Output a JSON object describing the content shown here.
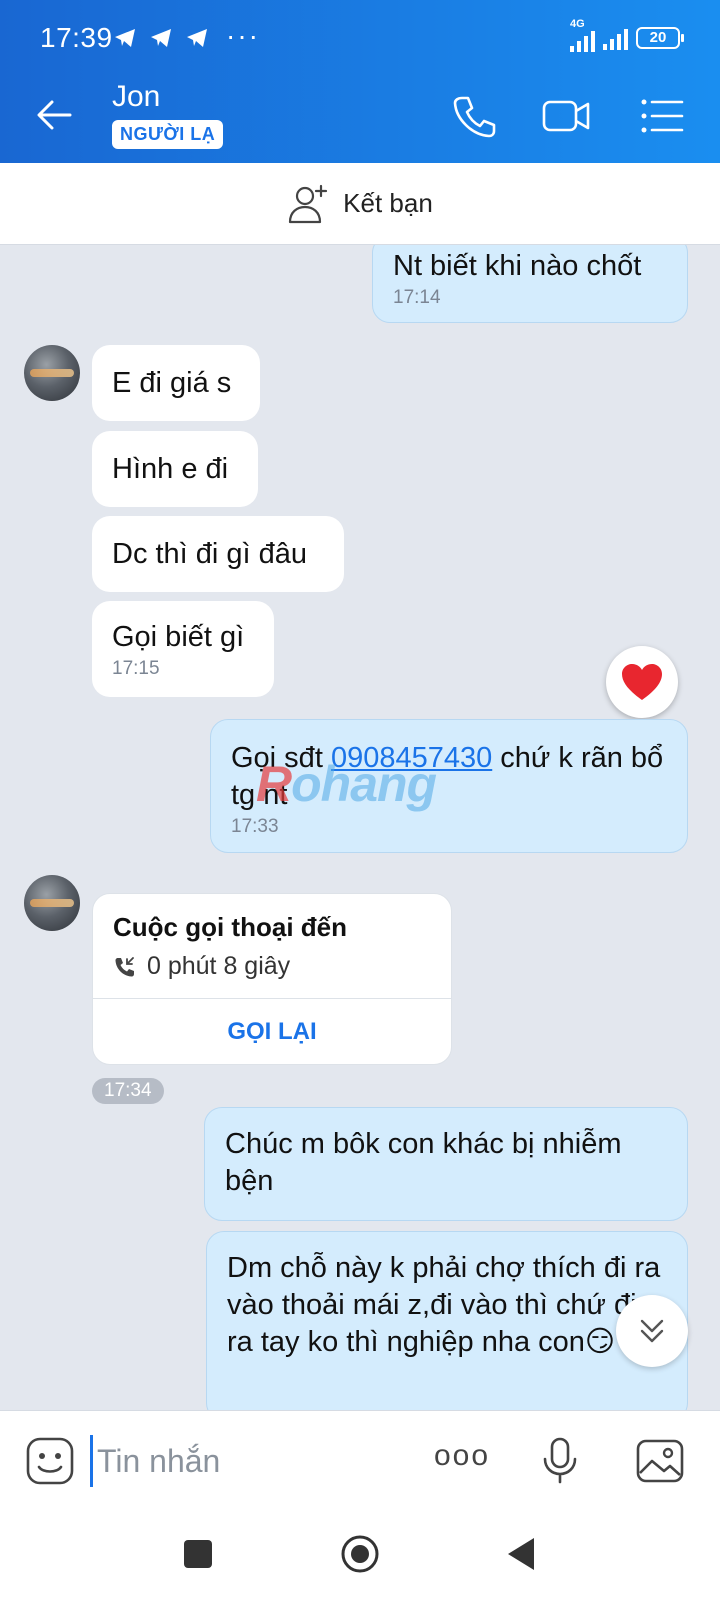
{
  "status_bar": {
    "time": "17:39",
    "network": "4G",
    "battery": "20"
  },
  "header": {
    "name": "Jon",
    "badge": "NGƯỜI LẠ"
  },
  "friend_bar": {
    "label": "Kết bạn"
  },
  "messages": {
    "m0": {
      "text": "Nt biết khi nào chốt",
      "time": "17:14"
    },
    "m1": {
      "text": "E đi giá s"
    },
    "m2": {
      "text": "Hình e đi"
    },
    "m3": {
      "text": "Dc thì đi gì đâu"
    },
    "m4": {
      "text": "Gọi biết gì",
      "time": "17:15"
    },
    "m5": {
      "text_before": "Gọi sđt ",
      "phone": "0908457430",
      "text_after": " chứ k rãn bổ tg nt",
      "time": "17:33"
    },
    "m7": {
      "text": "Chúc m bôk con khác bị nhiễm bện"
    },
    "m8": {
      "text": "Dm chỗ này k phải chợ thích đi ra vào thoải mái z,đi vào thì chứ đi ra tay ko thì nghiệp nha con😏"
    }
  },
  "call_card": {
    "title": "Cuộc gọi thoại đến",
    "duration": "0 phút 8 giây",
    "action": "GỌI LẠI",
    "time": "17:34"
  },
  "watermark": {
    "r": "R",
    "rest": "ohang"
  },
  "input_bar": {
    "placeholder": "Tin nhắn",
    "more": "ooo"
  }
}
